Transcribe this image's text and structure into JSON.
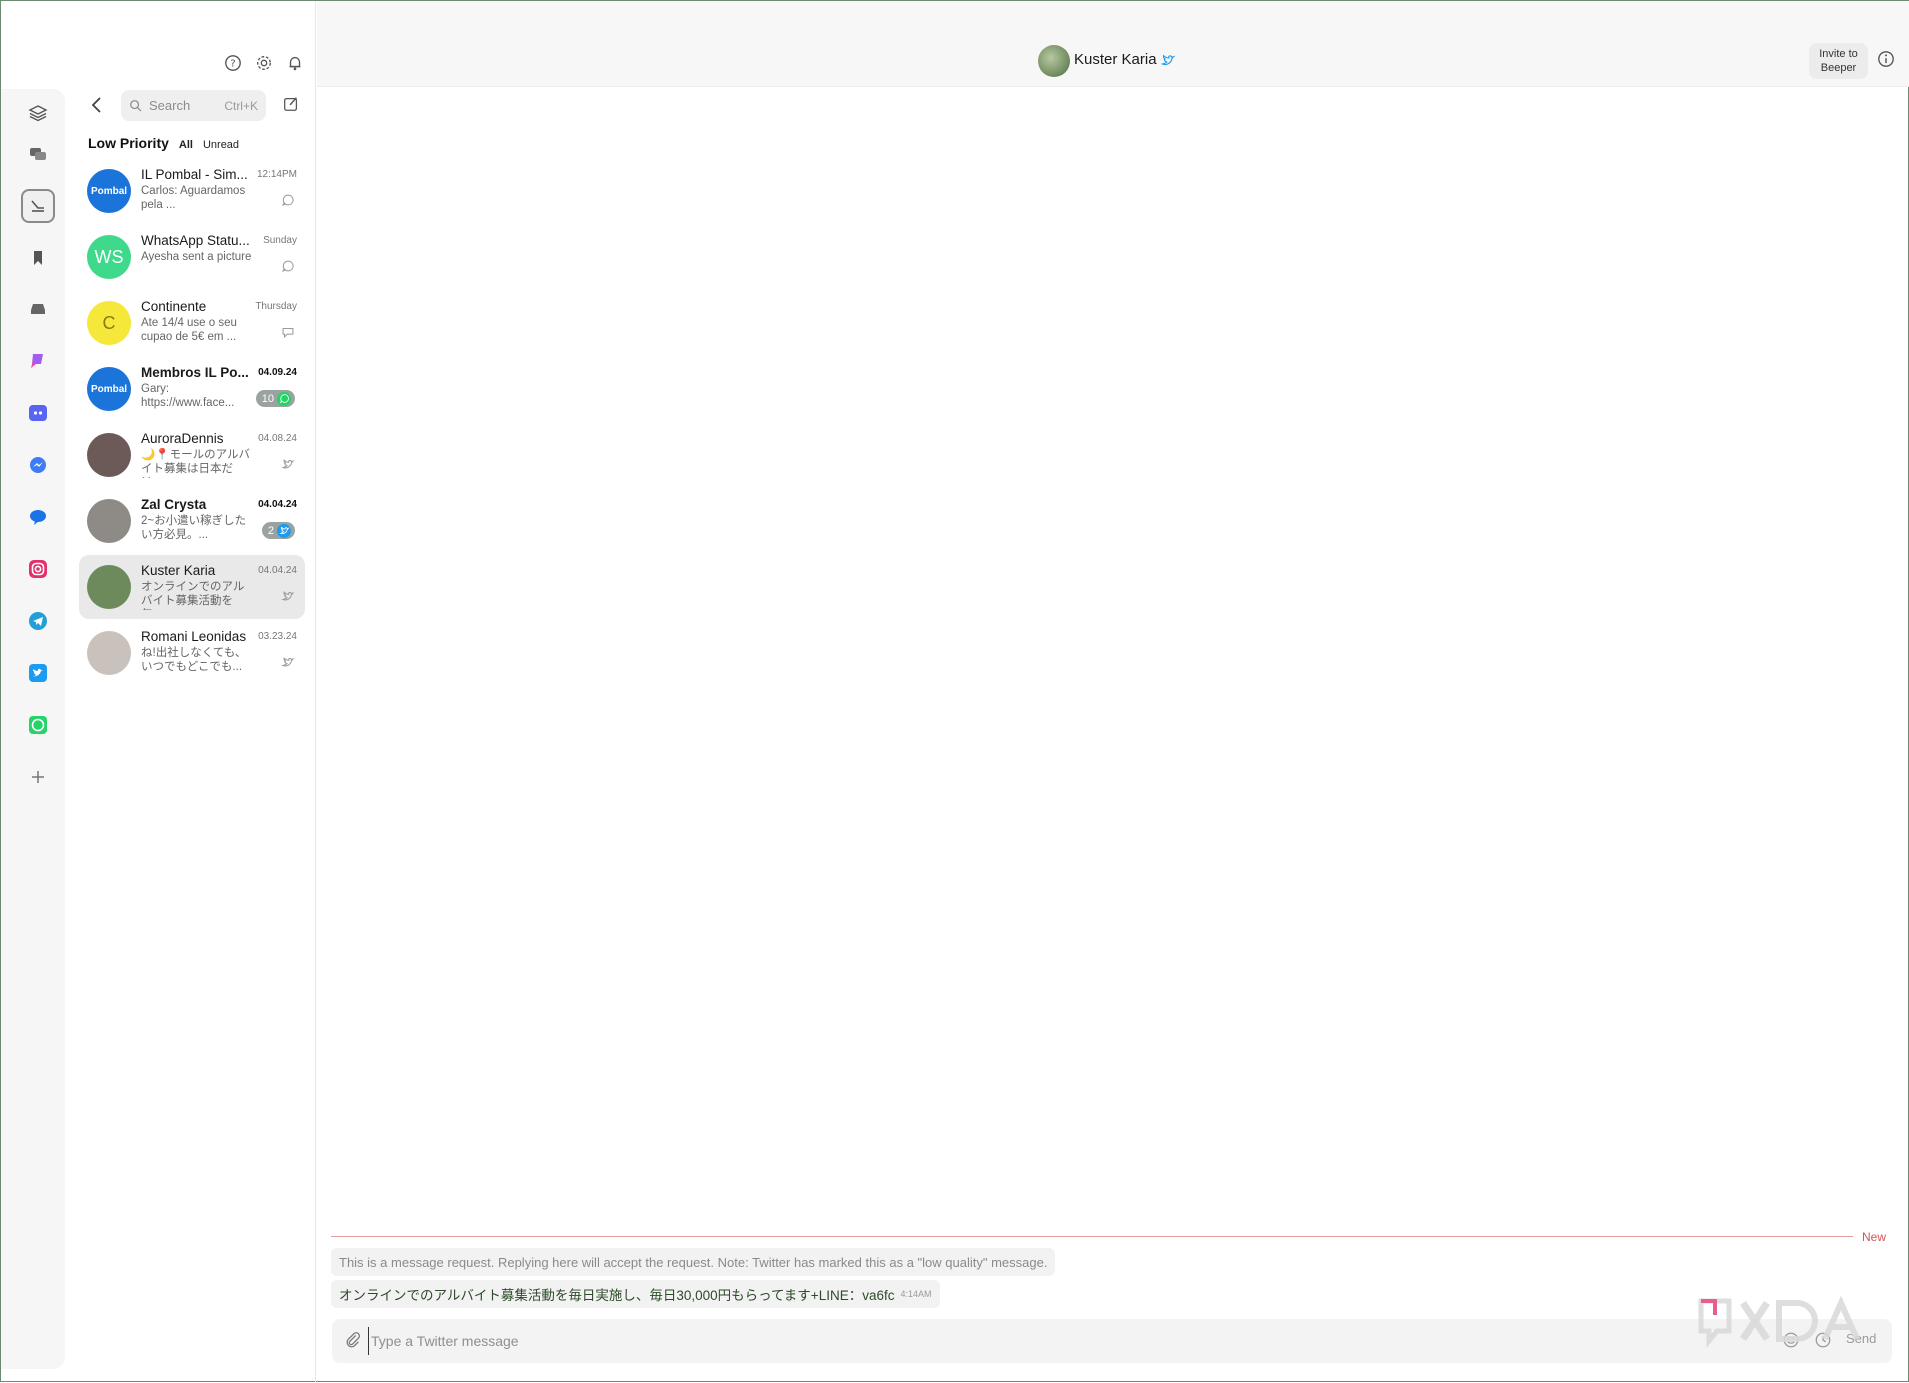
{
  "window": {
    "minimize": "—",
    "maximize": "☐",
    "close": "✕"
  },
  "list": {
    "search_placeholder": "Search",
    "search_shortcut": "Ctrl+K",
    "filter_title": "Low Priority",
    "filter_all": "All",
    "filter_unread": "Unread",
    "chats": [
      {
        "name": "IL Pombal - Sim...",
        "time": "12:14PM",
        "preview": "Carlos: Aguardamos pela ...",
        "avatar_text": "Pombal",
        "avatar_color": "#1a74d9",
        "network": "whatsapp"
      },
      {
        "name": "WhatsApp Statu...",
        "time": "Sunday",
        "preview": "Ayesha sent a picture",
        "avatar_text": "WS",
        "avatar_color": "#3fd98b",
        "network": "whatsapp"
      },
      {
        "name": "Continente",
        "time": "Thursday",
        "preview": "Ate 14/4 use o seu cupao de 5€ em ...",
        "avatar_text": "C",
        "avatar_color": "#f6e83a",
        "network": "chat"
      },
      {
        "name": "Membros IL Po...",
        "time": "04.09.24",
        "preview": "Gary: https://www.face...",
        "avatar_text": "Pombal",
        "avatar_color": "#1a74d9",
        "badge": "10",
        "network": "whatsapp"
      },
      {
        "name": "AuroraDennis",
        "time": "04.08.24",
        "preview": "🌙📍モールのアルバイト募集は日本だけ...",
        "avatar_text": "",
        "avatar_color": "#6b5a57",
        "network": "twitter"
      },
      {
        "name": "Zal Crysta",
        "time": "04.04.24",
        "preview": "2~お小遣い稼ぎしたい方必見。...",
        "avatar_text": "",
        "avatar_color": "#8e8a86",
        "badge": "2",
        "network": "twitter"
      },
      {
        "name": "Kuster Karia",
        "time": "04.04.24",
        "preview": "オンラインでのアルバイト募集活動を毎...",
        "avatar_text": "",
        "avatar_color": "#6d8a5c",
        "network": "twitter"
      },
      {
        "name": "Romani Leonidas",
        "time": "03.23.24",
        "preview": "ね!出社しなくても、いつでもどこでも...",
        "avatar_text": "",
        "avatar_color": "#c9c2bc",
        "network": "twitter"
      }
    ]
  },
  "header": {
    "name": "Kuster Karia",
    "invite_line1": "Invite to",
    "invite_line2": "Beeper"
  },
  "messages": {
    "new_label": "New",
    "notice": "This is a message request. Replying here will accept the request. Note: Twitter has marked this as a \"low quality\" message.",
    "text": "オンラインでのアルバイト募集活動を毎日実施し、毎日30,000円もらってます+LINE：va6fc",
    "time": "4:14AM"
  },
  "composer": {
    "placeholder": "Type a Twitter message",
    "send": "Send"
  },
  "colors": {
    "whatsapp": "#25d366",
    "twitter": "#1d9bf0",
    "discord": "#5865f2",
    "instagram": "#e1306c",
    "telegram": "#229ed9",
    "accent_new": "#d9534f"
  }
}
